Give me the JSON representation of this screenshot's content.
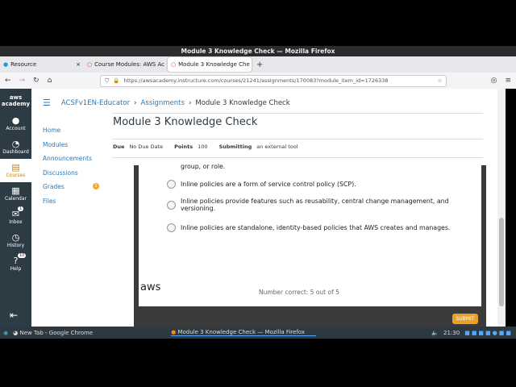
{
  "window": {
    "title": "Module 3 Knowledge Check — Mozilla Firefox"
  },
  "tabs": [
    {
      "label": "Resource"
    },
    {
      "label": "Course Modules: AWS Ac"
    },
    {
      "label": "Module 3 Knowledge Che"
    }
  ],
  "url": "https://awsacademy.instructure.com/courses/21241/assignments/170083?module_item_id=1726338",
  "global_nav": [
    {
      "label": "Account",
      "icon": "👤"
    },
    {
      "label": "Dashboard",
      "icon": "◔"
    },
    {
      "label": "Courses",
      "icon": "▤"
    },
    {
      "label": "Calendar",
      "icon": "▦"
    },
    {
      "label": "Inbox",
      "icon": "✉",
      "badge": "1"
    },
    {
      "label": "History",
      "icon": "◷"
    },
    {
      "label": "Help",
      "icon": "?",
      "badge": "10"
    }
  ],
  "logo": "aws academy",
  "breadcrumb": [
    "ACSFv1EN-Educator",
    "Assignments",
    "Module 3 Knowledge Check"
  ],
  "course_nav": [
    {
      "label": "Home"
    },
    {
      "label": "Modules"
    },
    {
      "label": "Announcements"
    },
    {
      "label": "Discussions"
    },
    {
      "label": "Grades",
      "badge": "3"
    },
    {
      "label": "Files"
    }
  ],
  "title": "Module 3 Knowledge Check",
  "meta": {
    "due_label": "Due",
    "due": "No Due Date",
    "points_label": "Points",
    "points": "100",
    "submitting_label": "Submitting",
    "submitting": "an external tool"
  },
  "quiz": {
    "partial_option": "group, or role.",
    "options": [
      "Inline policies are a form of service control policy (SCP).",
      "Inline policies provide features such as reusability, central change management, and versioning.",
      "Inline policies are standalone, identity-based policies that AWS creates and manages."
    ],
    "footer_logo": "aws",
    "score": "Number correct: 5 out of 5",
    "submit": "SUBMIT"
  },
  "taskbar": {
    "chrome": "New Tab - Google Chrome",
    "firefox": "Module 3 Knowledge Check — Mozilla Firefox",
    "time": "21:30"
  }
}
